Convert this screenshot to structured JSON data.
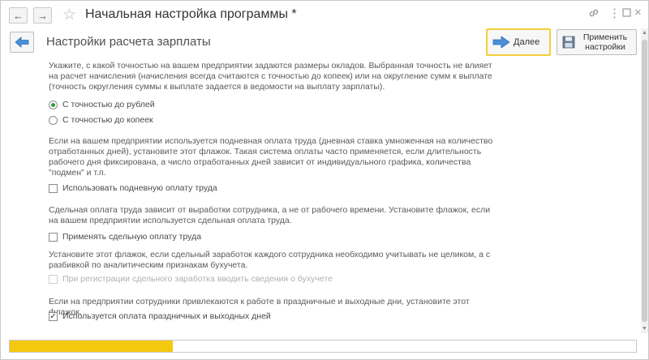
{
  "window": {
    "title": "Начальная настройка программы *",
    "icons": [
      "link-icon",
      "more-icon",
      "maximize-icon",
      "close-icon"
    ]
  },
  "header": {
    "page_title": "Настройки расчета зарплаты",
    "next_label": "Далее",
    "apply_label_1": "Применить",
    "apply_label_2": "настройки"
  },
  "content": {
    "p1": "Укажите, с какой точностью на вашем предприятии задаются размеры окладов. Выбранная точность не влияет на расчет начисления (начисления всегда считаются с точностью до копеек) или на округление сумм к выплате (точность округления суммы к выплате задается в ведомости на выплату зарплаты).",
    "radio_rub": "С точностью до рублей",
    "radio_kop": "С точностью до копеек",
    "radio_selected": "rub",
    "p2": "Если на вашем предприятии используется подневная оплата труда (дневная ставка умноженная на количество отработанных дней), установите этот флажок. Такая система оплаты часто применяется, если длительность рабочего дня фиксирована, а число отработанных дней зависит от индивидуального графика, количества \"подмен\" и т.п.",
    "chk_daily": "Использовать подневную оплату труда",
    "p3": "Сдельная оплата труда зависит от выработки сотрудника, а не от рабочего времени. Установите флажок, если на вашем предприятии используется сдельная оплата труда.",
    "chk_piece": "Применять сдельную оплату труда",
    "p4": "Установите этот флажок, если сдельный заработок каждого сотрудника необходимо учитывать не целиком, а с разбивкой по аналитическим признакам бухучета.",
    "chk_analytics": "При регистрации сдельного заработка вводить сведения о бухучете",
    "p5": "Если на предприятии сотрудники привлекаются к работе в праздничные и выходные дни, установите этот флажок.",
    "chk_holiday": "Используется оплата праздничных и выходных дней",
    "chk_holiday_checked": true
  },
  "progress": {
    "fraction": 0.26,
    "color": "#f4c80f"
  },
  "colors": {
    "accent_arrow": "#4a90d9",
    "highlight_border": "#f2cf3a",
    "radio_selected": "#2f9a3a"
  }
}
